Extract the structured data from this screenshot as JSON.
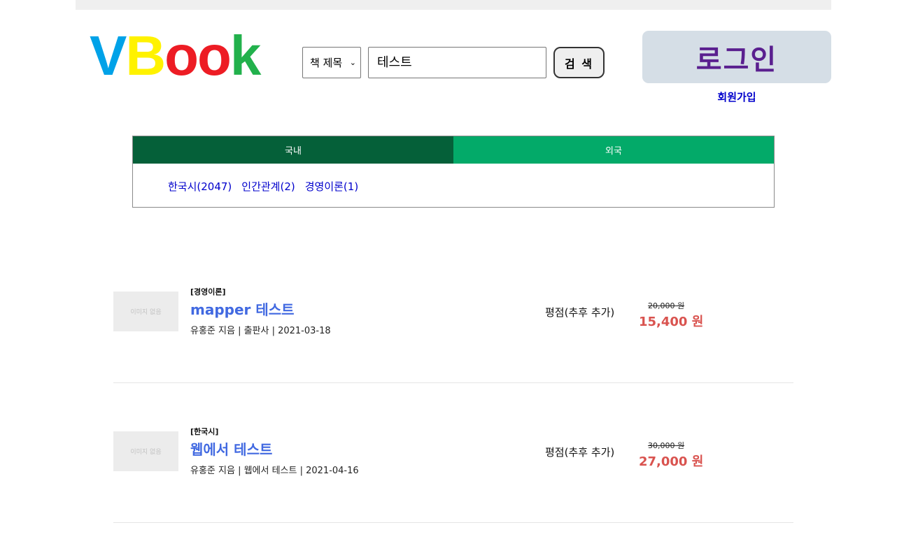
{
  "header": {
    "logo": {
      "letters": [
        {
          "char": "V",
          "color": "#00a2e8"
        },
        {
          "char": "B",
          "color": "#fff200"
        },
        {
          "char": "o",
          "color": "#ed1c24"
        },
        {
          "char": "o",
          "color": "#ed1c24"
        },
        {
          "char": "k",
          "color": "#22b14c"
        }
      ]
    },
    "search": {
      "select_value": "책 제목",
      "input_value": "테스트",
      "button_label": "검 색"
    },
    "login_label": "로그인",
    "signup_label": "회원가입"
  },
  "categories": {
    "tabs": [
      {
        "label": "국내",
        "active": true
      },
      {
        "label": "외국",
        "active": false
      }
    ],
    "links": [
      "한국시(2047)",
      "인간관계(2)",
      "경영이론(1)"
    ]
  },
  "books": [
    {
      "thumb_text": "이미지 없음",
      "category": "[경영이론]",
      "title": "mapper 테스트",
      "meta": "유홍준 지음 | 출판사 | 2021-03-18",
      "rating": "평점(추후 추가)",
      "original_price": "20,000 원",
      "sale_price": "15,400 원"
    },
    {
      "thumb_text": "이미지 없음",
      "category": "[한국시]",
      "title": "웹에서 테스트",
      "meta": "유홍준 지음 | 웹에서 테스트 | 2021-04-16",
      "rating": "평점(추후 추가)",
      "original_price": "30,000 원",
      "sale_price": "27,000 원"
    }
  ]
}
